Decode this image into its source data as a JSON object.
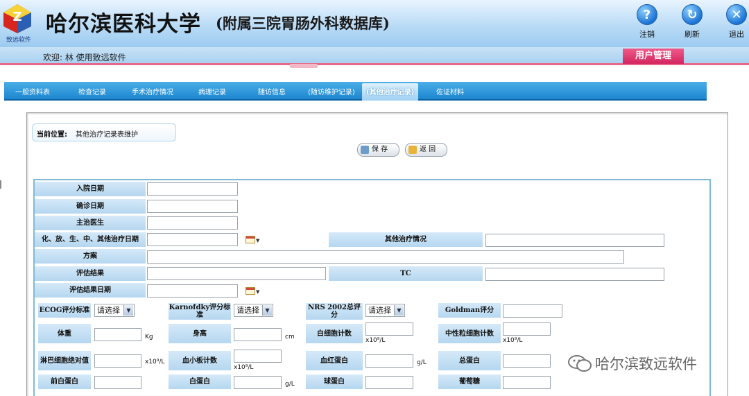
{
  "header": {
    "logo_caption": "致远软件",
    "title": "哈尔滨医科大学",
    "subtitle": "(附属三院胃肠外科数据库)",
    "buttons": [
      {
        "label": "注销",
        "icon": "question-icon"
      },
      {
        "label": "刷新",
        "icon": "refresh-icon"
      },
      {
        "label": "退出",
        "icon": "close-icon"
      }
    ]
  },
  "welcome": {
    "text": "欢迎:  林  使用致远软件",
    "user_mgmt": "用户管理"
  },
  "tabs": [
    {
      "label": "一般资料表",
      "active": false
    },
    {
      "label": "检查记录",
      "active": false
    },
    {
      "label": "手术治疗情况",
      "active": false
    },
    {
      "label": "病理记录",
      "active": false
    },
    {
      "label": "随访信息",
      "active": false
    },
    {
      "label": "(随访维护记录)",
      "active": false
    },
    {
      "label": "(其他治疗记录)",
      "active": true
    },
    {
      "label": "佐证材料",
      "active": false
    }
  ],
  "breadcrumb": {
    "prefix": "当前位置:",
    "location": "其他治疗记录表维护"
  },
  "actions": {
    "save": "保 存",
    "back": "返 回"
  },
  "form": {
    "admit_date": "入院日期",
    "diagnosis_date": "确诊日期",
    "attending_doctor": "主治医生",
    "treatment_date": "化、放、生、中、其他治疗日期",
    "other_treatment": "其他治疗情况",
    "plan": "方案",
    "eval_result": "评估结果",
    "tc": "TC",
    "eval_date": "评估结果日期",
    "ecog": "ECOG评分标准",
    "karnofsky": "Karnofdky评分标准",
    "nrs": "NRS 2002总评分",
    "goldman": "Goldman评分",
    "select_placeholder": "请选择",
    "weight": "体重",
    "height": "身高",
    "wbc": "白细胞计数",
    "neutrophil": "中性粒细胞计数",
    "lymph": "淋巴细胞绝对值",
    "platelet": "血小板计数",
    "hemoglobin": "血红蛋白",
    "total_protein": "总蛋白",
    "prealbumin": "前白蛋白",
    "albumin": "白蛋白",
    "globulin": "球蛋白",
    "glucose": "葡萄糖",
    "unit_kg": "Kg",
    "unit_cm": "cm",
    "unit_x10": "x10⁹/L",
    "unit_gl": "g/L"
  },
  "watermark": "哈尔滨致远软件",
  "colors": {
    "header_bg": "#b9dbf6",
    "tab_bg": "#1d86cf",
    "label_bg": "#c4e0f4",
    "user_mgmt_bg": "#e0306c"
  }
}
